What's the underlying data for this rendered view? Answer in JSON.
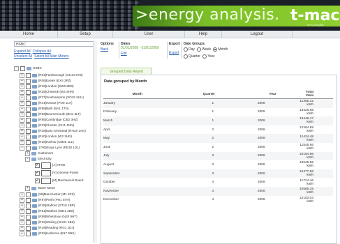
{
  "banner": {
    "tagline": ">energy analysis.",
    "logo": "t-mac",
    "logo_sub": "tech-nologies"
  },
  "nav": [
    "Home",
    "Setup",
    "User",
    "Help",
    "Logout"
  ],
  "sidebar": {
    "search_value": "HSBC",
    "expand_all": "Expand All",
    "collapse_all": "Collapse All",
    "unselect_all": "Unselect All",
    "select_all_main_meters": "Select All Main Meters",
    "tree": [
      "HSBC",
      "[R04]Farnborough (GU14 6YB)",
      "[R06]Exeter (EX4 3PZ)",
      "[R19]London (SW6 6EB)",
      "[R29]Chiswick (W4 4HR)",
      "[R37]Southampton (SO18 2HU)",
      "[R41]Havant (PO9 1LA)",
      "[R58]Bath (BA1 1TN)",
      "[R63]Bournemouth (BH1 3LT)",
      "[R95]Cambridge (CB2 3HZ)",
      "[R33]Chester (CH1 1NN)",
      "[R28]East Grinstead (RH19 1AG)",
      "[R40]London (W2 2HR)",
      "[R15]Harlow (CM20 1LL)",
      "1790]Kings Lynn (PE30 1DL)",
      "Customers",
      "Electricity",
      "[A] ATMs",
      "[V] General Power",
      "[M] Mechanical Board",
      "Water Meter",
      "[99]Manchester (M1 6FZ)",
      "[R97]Perth (PH1 5TH)",
      "[R39]Stafford (ST16 2BP)",
      "[R61]Watford (WD1 2BS)",
      "[R89]Whetstone (N20 9HT)",
      "[R11]Woking (GU21 1BZ)",
      "[R18]Reading (RG1 1DJ)",
      "[R63]Harborne (B17 9NS)"
    ]
  },
  "toolbar": {
    "options_label": "Options",
    "back_link": "Back",
    "dates_label": "Dates",
    "dates_value": "01/01/2008 - 01/01/2009",
    "edit_link": "Edit",
    "export_label": "Export",
    "export_link": "Export",
    "date_groups_label": "Date Groups",
    "day": "Day",
    "week": "Week",
    "month": "Month",
    "quarter": "Quarter",
    "year": "Year"
  },
  "report": {
    "tab_label": "Grouped Data Report",
    "title": "Data grouped by Month",
    "columns": [
      "Month",
      "Quarter",
      "Year",
      "Total Data"
    ],
    "rows": [
      [
        "January",
        "1",
        "2008",
        "11355.32 kWh"
      ],
      [
        "February",
        "1",
        "2008",
        "13426.98 kWh"
      ],
      [
        "March",
        "1",
        "2008",
        "13448.47 kWh"
      ],
      [
        "April",
        "2",
        "2008",
        "12264.89 kWh"
      ],
      [
        "May",
        "2",
        "2008",
        "11424.48 kWh"
      ],
      [
        "June",
        "2",
        "2008",
        "11545.86 kWh"
      ],
      [
        "July",
        "3",
        "2008",
        "10184.86 kWh"
      ],
      [
        "August",
        "3",
        "2008",
        "10648.85 kWh"
      ],
      [
        "September",
        "3",
        "2008",
        "12477.86 kWh"
      ],
      [
        "October",
        "4",
        "2008",
        "11724.46 kWh"
      ],
      [
        "November",
        "4",
        "2008",
        "10585.25 kWh"
      ],
      [
        "December",
        "4",
        "2008",
        "12183.03 kWh"
      ]
    ]
  }
}
